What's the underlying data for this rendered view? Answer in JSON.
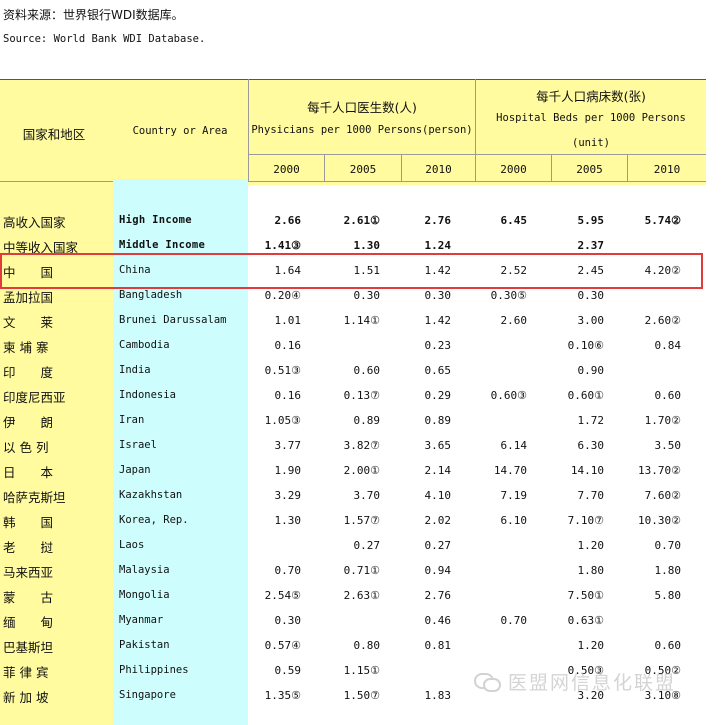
{
  "source": {
    "cn": "资料来源：世界银行WDI数据库。",
    "en": "Source: World Bank WDI Database."
  },
  "header": {
    "country_cn": "国家和地区",
    "country_en": "Country or Area",
    "physicians_cn": "每千人口医生数(人)",
    "physicians_en": "Physicians per 1000 Persons(person)",
    "beds_cn": "每千人口病床数(张)",
    "beds_en_1": "Hospital Beds per 1000 Persons",
    "beds_en_2": "(unit)",
    "years": [
      "2000",
      "2005",
      "2010",
      "2000",
      "2005",
      "2010"
    ]
  },
  "rows": [
    {
      "cn": "高收入国家",
      "en": "High Income",
      "bold": true,
      "v": [
        "2.66",
        "2.61①",
        "2.76",
        "6.45",
        "5.95",
        "5.74②"
      ]
    },
    {
      "cn": "中等收入国家",
      "en": "Middle Income",
      "bold": true,
      "v": [
        "1.41③",
        "1.30",
        "1.24",
        "",
        "2.37",
        ""
      ]
    },
    {
      "cn": "中　　国",
      "en": "China",
      "bold": false,
      "v": [
        "1.64",
        "1.51",
        "1.42",
        "2.52",
        "2.45",
        "4.20②"
      ]
    },
    {
      "cn": "孟加拉国",
      "en": "Bangladesh",
      "bold": false,
      "v": [
        "0.20④",
        "0.30",
        "0.30",
        "0.30⑤",
        "0.30",
        ""
      ]
    },
    {
      "cn": "文　　莱",
      "en": "Brunei Darussalam",
      "bold": false,
      "v": [
        "1.01",
        "1.14①",
        "1.42",
        "2.60",
        "3.00",
        "2.60②"
      ]
    },
    {
      "cn": "柬 埔 寨",
      "en": "Cambodia",
      "bold": false,
      "v": [
        "0.16",
        "",
        "0.23",
        "",
        "0.10⑥",
        "0.84"
      ]
    },
    {
      "cn": "印　　度",
      "en": "India",
      "bold": false,
      "v": [
        "0.51③",
        "0.60",
        "0.65",
        "",
        "0.90",
        ""
      ]
    },
    {
      "cn": "印度尼西亚",
      "en": "Indonesia",
      "bold": false,
      "v": [
        "0.16",
        "0.13⑦",
        "0.29",
        "0.60③",
        "0.60①",
        "0.60"
      ]
    },
    {
      "cn": "伊　　朗",
      "en": "Iran",
      "bold": false,
      "v": [
        "1.05③",
        "0.89",
        "0.89",
        "",
        "1.72",
        "1.70②"
      ]
    },
    {
      "cn": "以 色 列",
      "en": "Israel",
      "bold": false,
      "v": [
        "3.77",
        "3.82⑦",
        "3.65",
        "6.14",
        "6.30",
        "3.50"
      ]
    },
    {
      "cn": "日　　本",
      "en": "Japan",
      "bold": false,
      "v": [
        "1.90",
        "2.00①",
        "2.14",
        "14.70",
        "14.10",
        "13.70②"
      ]
    },
    {
      "cn": "哈萨克斯坦",
      "en": "Kazakhstan",
      "bold": false,
      "v": [
        "3.29",
        "3.70",
        "4.10",
        "7.19",
        "7.70",
        "7.60②"
      ]
    },
    {
      "cn": "韩　　国",
      "en": "Korea, Rep.",
      "bold": false,
      "v": [
        "1.30",
        "1.57⑦",
        "2.02",
        "6.10",
        "7.10⑦",
        "10.30②"
      ]
    },
    {
      "cn": "老　　挝",
      "en": "Laos",
      "bold": false,
      "v": [
        "",
        "0.27",
        "0.27",
        "",
        "1.20",
        "0.70"
      ]
    },
    {
      "cn": "马来西亚",
      "en": "Malaysia",
      "bold": false,
      "v": [
        "0.70",
        "0.71①",
        "0.94",
        "",
        "1.80",
        "1.80"
      ]
    },
    {
      "cn": "蒙　　古",
      "en": "Mongolia",
      "bold": false,
      "v": [
        "2.54⑤",
        "2.63①",
        "2.76",
        "",
        "7.50①",
        "5.80"
      ]
    },
    {
      "cn": "缅　　甸",
      "en": "Myanmar",
      "bold": false,
      "v": [
        "0.30",
        "",
        "0.46",
        "0.70",
        "0.63①",
        ""
      ]
    },
    {
      "cn": "巴基斯坦",
      "en": "Pakistan",
      "bold": false,
      "v": [
        "0.57④",
        "0.80",
        "0.81",
        "",
        "1.20",
        "0.60"
      ]
    },
    {
      "cn": "菲 律 宾",
      "en": "Philippines",
      "bold": false,
      "v": [
        "0.59",
        "1.15①",
        "",
        "",
        "0.50③",
        "0.50②"
      ]
    },
    {
      "cn": "新 加 坡",
      "en": "Singapore",
      "bold": false,
      "v": [
        "1.35⑤",
        "1.50⑦",
        "1.83",
        "",
        "3.20",
        "3.10⑧"
      ]
    }
  ],
  "watermark": "医盟网信息化联盟",
  "colors": {
    "country_cn_bg": "#fffb9e",
    "country_en_bg": "#cdfdfd",
    "highlight": "#e23b3b"
  }
}
